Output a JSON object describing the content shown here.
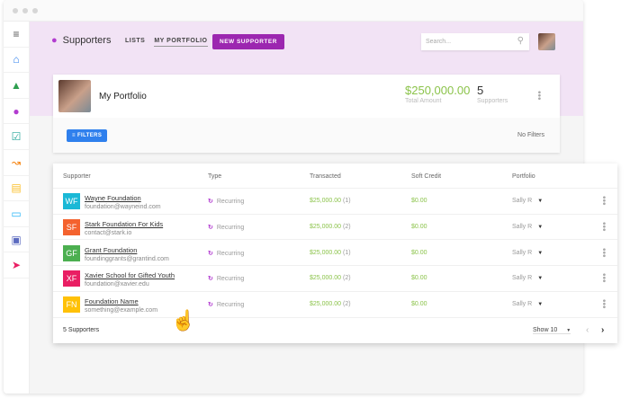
{
  "header": {
    "title": "Supporters",
    "nav": [
      "LISTS",
      "MY PORTFOLIO"
    ],
    "new_button": "NEW SUPPORTER",
    "search_placeholder": "Search..."
  },
  "sidebar": {
    "icons": [
      "menu-icon",
      "home-icon",
      "bank-icon",
      "supporters-icon",
      "tasks-icon",
      "reports-icon",
      "notes-icon",
      "monitor-icon",
      "calendar-icon",
      "send-icon"
    ],
    "colors": [
      "#555",
      "#2f80ed",
      "#2e9e4f",
      "#b23cd0",
      "#26a69a",
      "#f57c00",
      "#fbc02d",
      "#29b6f6",
      "#5c6bc0",
      "#e91e63"
    ]
  },
  "portfolio": {
    "title": "My Portfolio",
    "total_amount": "$250,000.00",
    "total_label": "Total Amount",
    "supporters_count": "5",
    "supporters_label": "Supporters",
    "filters_button": "FILTERS",
    "filters_status": "No Filters"
  },
  "table": {
    "columns": [
      "Supporter",
      "Type",
      "Transacted",
      "Soft Credit",
      "Portfolio"
    ],
    "rows": [
      {
        "initials": "WF",
        "color": "#1ab8d6",
        "name": "Wayne Foundation",
        "email": "foundation@wayneind.com",
        "type": "Recurring",
        "transacted": "$25,000.00",
        "tx_count": "(1)",
        "soft_credit": "$0.00",
        "portfolio": "Sally R"
      },
      {
        "initials": "SF",
        "color": "#f4622e",
        "name": "Stark Foundation For Kids",
        "email": "contact@stark.io",
        "type": "Recurring",
        "transacted": "$25,000.00",
        "tx_count": "(2)",
        "soft_credit": "$0.00",
        "portfolio": "Sally R"
      },
      {
        "initials": "GF",
        "color": "#4caf50",
        "name": "Grant Foundation",
        "email": "foundinggrants@grantind.com",
        "type": "Recurring",
        "transacted": "$25,000.00",
        "tx_count": "(1)",
        "soft_credit": "$0.00",
        "portfolio": "Sally R"
      },
      {
        "initials": "XF",
        "color": "#e91e63",
        "name": "Xavier School for Gifted Youth",
        "email": "foundation@xavier.edu",
        "type": "Recurring",
        "transacted": "$25,000.00",
        "tx_count": "(2)",
        "soft_credit": "$0.00",
        "portfolio": "Sally R"
      },
      {
        "initials": "FN",
        "color": "#ffc107",
        "name": "Foundation Name",
        "email": "something@example.com",
        "type": "Recurring",
        "transacted": "$25,000.00",
        "tx_count": "(2)",
        "soft_credit": "$0.00",
        "portfolio": "Sally R"
      }
    ],
    "footer": {
      "count": "5 Supporters",
      "show": "Show 10"
    }
  }
}
